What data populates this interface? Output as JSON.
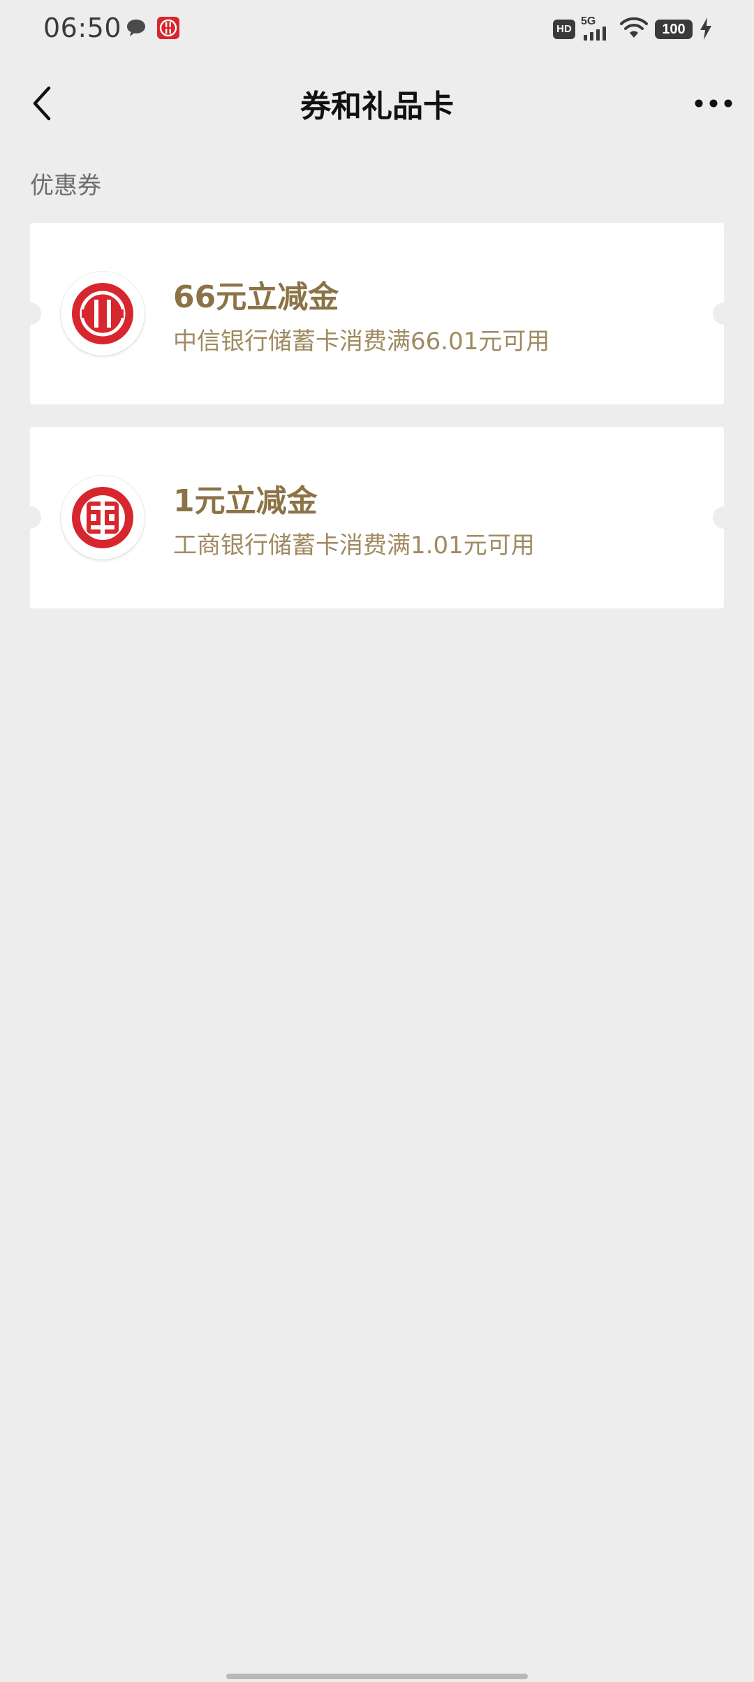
{
  "status_bar": {
    "time": "06:50",
    "icons": {
      "chat": "chat-bubble-icon",
      "bank": "citic-bank-icon",
      "hd": "HD",
      "network": "5G",
      "wifi": "wifi-icon",
      "bolt": "charging-bolt-icon"
    },
    "battery": "100"
  },
  "nav": {
    "title": "券和礼品卡",
    "back_icon": "chevron-left-icon",
    "more_icon": "more-dots-icon"
  },
  "section": {
    "title": "优惠券"
  },
  "coupons": [
    {
      "bank_logo": "citic-bank-logo",
      "amount": "66元立减金",
      "condition": "中信银行储蓄卡消费满66.01元可用"
    },
    {
      "bank_logo": "icbc-bank-logo",
      "amount": "1元立减金",
      "condition": "工商银行储蓄卡消费满1.01元可用"
    }
  ],
  "colors": {
    "background": "#ededed",
    "card": "#ffffff",
    "coupon_title": "#8c7346",
    "coupon_text": "#a08a60",
    "bank_red": "#d7262d"
  }
}
